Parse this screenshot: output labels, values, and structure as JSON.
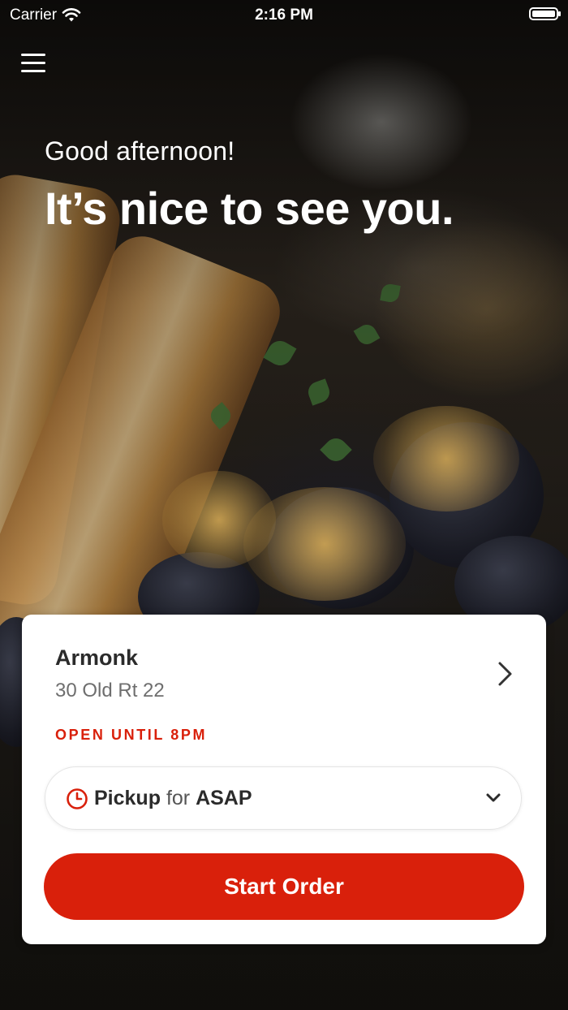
{
  "status_bar": {
    "carrier": "Carrier",
    "time": "2:16 PM"
  },
  "hero": {
    "greeting": "Good afternoon!",
    "headline": "It’s nice to see you."
  },
  "location": {
    "name": "Armonk",
    "address": "30 Old Rt 22",
    "hours_status": "OPEN UNTIL 8PM"
  },
  "order_mode": {
    "mode": "Pickup",
    "connector": "for",
    "time": "ASAP"
  },
  "actions": {
    "start_order": "Start Order"
  },
  "icons": {
    "menu": "hamburger-menu-icon",
    "location_chevron": "chevron-right-icon",
    "pickup_time": "clock-icon",
    "dropdown": "chevron-down-icon"
  },
  "colors": {
    "accent": "#d9200b",
    "card": "#ffffff",
    "text_primary": "#2b2b2b",
    "text_secondary": "#6e6e6e"
  }
}
